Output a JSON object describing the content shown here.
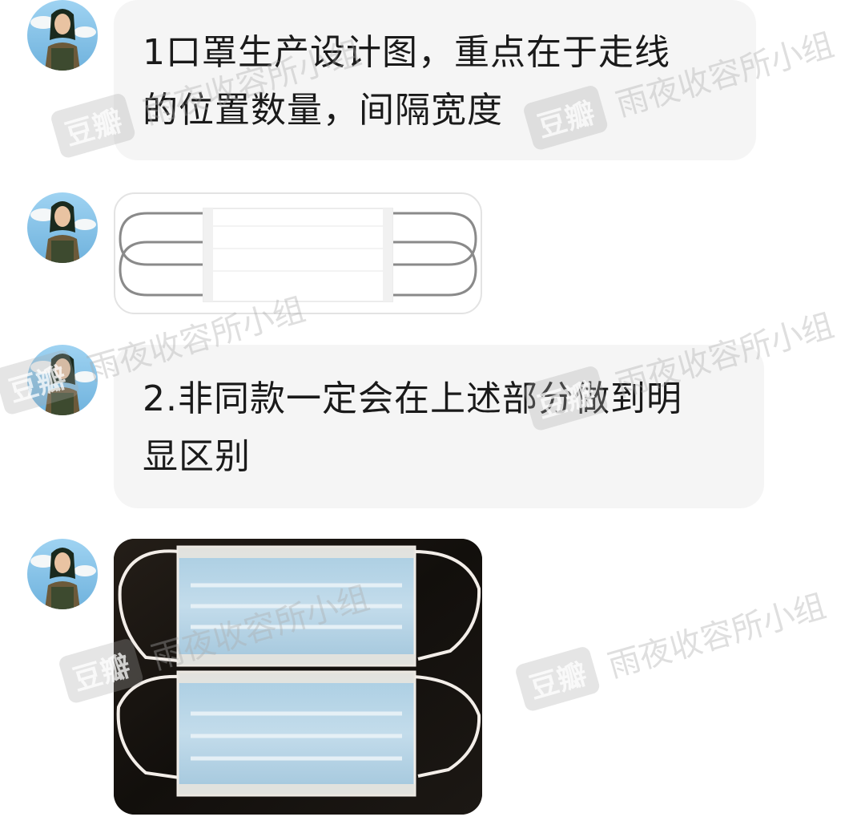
{
  "messages": [
    {
      "type": "text",
      "lines": [
        "1口罩生产设计图，重点在于走线",
        "的位置数量，间隔宽度"
      ]
    },
    {
      "type": "image",
      "image": "mask-design-diagram"
    },
    {
      "type": "text",
      "lines": [
        "2.非同款一定会在上述部分做到明",
        "显区别"
      ]
    },
    {
      "type": "image",
      "image": "mask-photo"
    }
  ],
  "watermark": {
    "logo": "豆瓣",
    "text": "雨夜收容所小组"
  },
  "colors": {
    "bubble": "#f5f5f5",
    "text": "#1a1a1a",
    "mask_blue": "#b9d6e6",
    "photo_bg": "#161310"
  }
}
